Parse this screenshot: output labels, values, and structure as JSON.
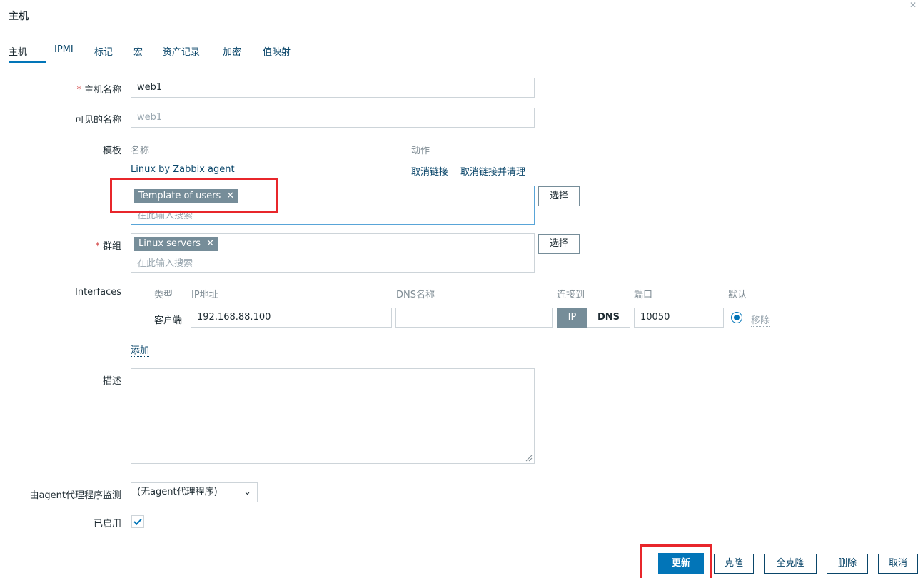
{
  "page": {
    "title": "主机"
  },
  "tabs": [
    {
      "label": "主机"
    },
    {
      "label": "IPMI"
    },
    {
      "label": "标记"
    },
    {
      "label": "宏"
    },
    {
      "label": "资产记录"
    },
    {
      "label": "加密"
    },
    {
      "label": "值映射"
    }
  ],
  "form": {
    "host_name": {
      "label": "主机名称",
      "value": "web1"
    },
    "visible_name": {
      "label": "可见的名称",
      "placeholder": "web1"
    },
    "templates": {
      "label": "模板",
      "col_name": "名称",
      "col_action": "动作",
      "linked": [
        {
          "name": "Linux by Zabbix agent",
          "unlink": "取消链接",
          "unlink_clear": "取消链接并清理"
        }
      ],
      "chips": [
        {
          "label": "Template of users"
        }
      ],
      "placeholder": "在此输入搜索",
      "select_label": "选择"
    },
    "groups": {
      "label": "群组",
      "chips": [
        {
          "label": "Linux servers"
        }
      ],
      "placeholder": "在此输入搜索",
      "select_label": "选择"
    },
    "interfaces": {
      "label": "Interfaces",
      "headers": {
        "type": "类型",
        "ip": "IP地址",
        "dns": "DNS名称",
        "connect": "连接到",
        "port": "端口",
        "default": "默认"
      },
      "rows": [
        {
          "type": "客户端",
          "ip": "192.168.88.100",
          "dns": "",
          "connect_ip": "IP",
          "connect_dns": "DNS",
          "port": "10050",
          "remove": "移除"
        }
      ],
      "add_label": "添加"
    },
    "description": {
      "label": "描述",
      "value": ""
    },
    "proxy": {
      "label": "由agent代理程序监测",
      "value": "(无agent代理程序)"
    },
    "enabled": {
      "label": "已启用",
      "checked": true
    }
  },
  "buttons": {
    "update": "更新",
    "clone": "克隆",
    "full_clone": "全克隆",
    "delete": "删除",
    "cancel": "取消"
  },
  "colors": {
    "accent": "#0275b8",
    "link": "#0a466a",
    "chip": "#768d99",
    "highlight": "#e8262b"
  }
}
